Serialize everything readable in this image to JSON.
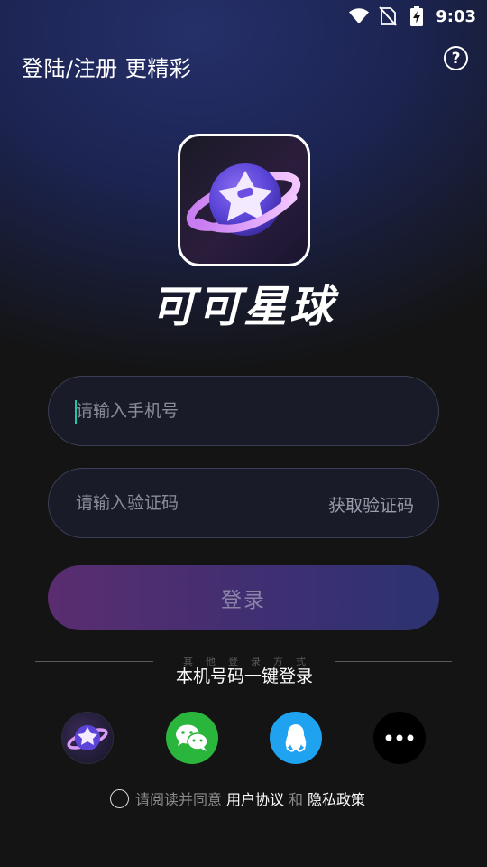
{
  "status_bar": {
    "time": "9:03",
    "icons": [
      "wifi-icon",
      "no-sim-icon",
      "battery-charging-icon"
    ]
  },
  "header": {
    "title": "登陆/注册 更精彩",
    "help_icon": "help-circle-icon",
    "help_glyph": "?"
  },
  "app": {
    "name": "可可星球",
    "logo_icon": "planet-star-logo-icon"
  },
  "form": {
    "phone_placeholder": "请输入手机号",
    "phone_value": "",
    "code_placeholder": "请输入验证码",
    "code_value": "",
    "get_code_label": "获取验证码",
    "login_label": "登录"
  },
  "other_login": {
    "label": "其他登录方式",
    "onekey_label": "本机号码一键登录",
    "methods": [
      {
        "name": "app",
        "icon": "planet-star-logo-icon"
      },
      {
        "name": "wechat",
        "icon": "wechat-icon",
        "color": "#2ab53c"
      },
      {
        "name": "qq",
        "icon": "qq-penguin-icon",
        "color": "#1fa2f0"
      },
      {
        "name": "more",
        "icon": "more-dots-icon",
        "color": "#000000"
      }
    ]
  },
  "agreement": {
    "prefix": "请阅读并同意",
    "user_agreement": "用户协议",
    "and": "和",
    "privacy_policy": "隐私政策",
    "checked": false
  },
  "colors": {
    "accent_caret": "#1fc7a8",
    "login_gradient_start": "#5a2d70",
    "login_gradient_end": "#2c3370",
    "header_bg": "#1c2452"
  }
}
